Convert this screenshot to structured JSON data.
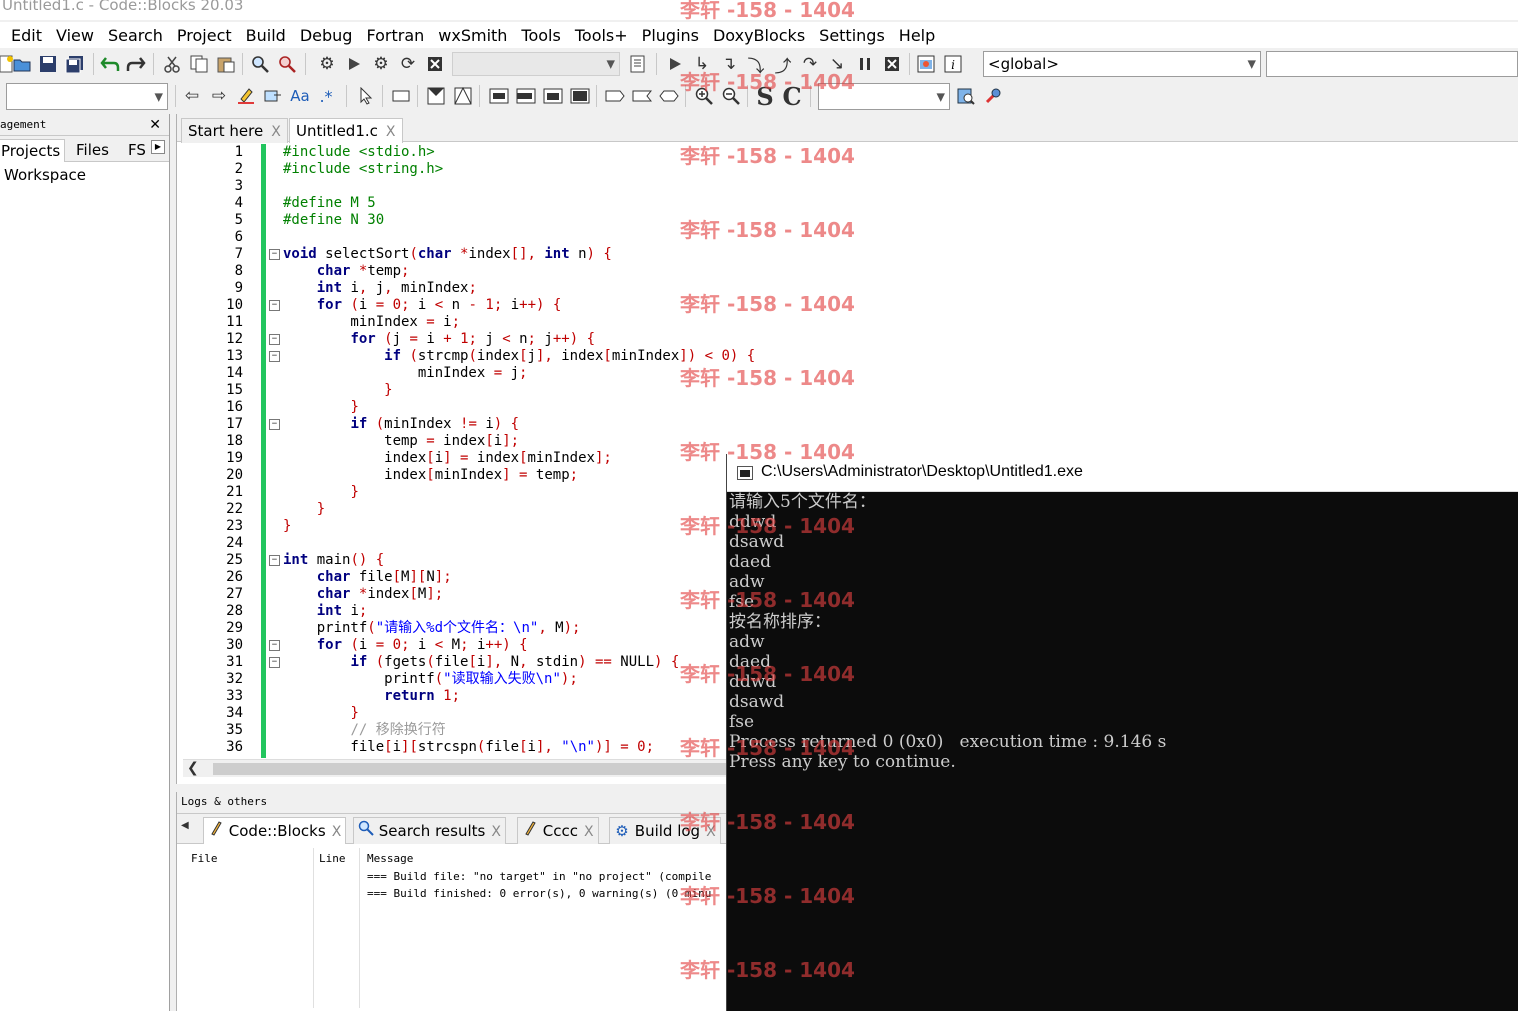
{
  "window": {
    "title": "Untitled1.c - Code::Blocks 20.03"
  },
  "menu": [
    "Edit",
    "View",
    "Search",
    "Project",
    "Build",
    "Debug",
    "Fortran",
    "wxSmith",
    "Tools",
    "Tools+",
    "Plugins",
    "DoxyBlocks",
    "Settings",
    "Help"
  ],
  "toolbar": {
    "scope_combo": "<global>",
    "target_combo": "",
    "search_combo_1": "",
    "search_combo_2": "",
    "doxy_s": "S",
    "doxy_c": "C",
    "font_a": "Aa",
    "regex": ".*"
  },
  "management": {
    "header": "Management",
    "header_visible": "agement",
    "tabs": [
      "Projects",
      "Files",
      "FS"
    ],
    "tree_root": "Workspace"
  },
  "editor": {
    "tabs": [
      {
        "label": "Start here",
        "close": "X"
      },
      {
        "label": "Untitled1.c",
        "close": "X"
      }
    ],
    "lines": [
      "#include <stdio.h>",
      "#include <string.h>",
      "",
      "#define M 5",
      "#define N 30",
      "",
      "void selectSort(char *index[], int n) {",
      "    char *temp;",
      "    int i, j, minIndex;",
      "    for (i = 0; i < n - 1; i++) {",
      "        minIndex = i;",
      "        for (j = i + 1; j < n; j++) {",
      "            if (strcmp(index[j], index[minIndex]) < 0) {",
      "                minIndex = j;",
      "            }",
      "        }",
      "        if (minIndex != i) {",
      "            temp = index[i];",
      "            index[i] = index[minIndex];",
      "            index[minIndex] = temp;",
      "        }",
      "    }",
      "}",
      "",
      "int main() {",
      "    char file[M][N];",
      "    char *index[M];",
      "    int i;",
      "    printf(\"请输入%d个文件名：\\n\", M);",
      "    for (i = 0; i < M; i++) {",
      "        if (fgets(file[i], N, stdin) == NULL) {",
      "            printf(\"读取输入失败\\n\");",
      "            return 1;",
      "        }",
      "        // 移除换行符",
      "        file[i][strcspn(file[i], \"\\n\")] = 0;"
    ]
  },
  "logs": {
    "header": "Logs & others",
    "tabs": [
      {
        "label": "Code::Blocks",
        "close": "X",
        "icon": "pencil-icon"
      },
      {
        "label": "Search results",
        "close": "X",
        "icon": "magnifier-icon"
      },
      {
        "label": "Cccc",
        "close": "X",
        "icon": "pencil-icon"
      },
      {
        "label": "Build log",
        "close": "X",
        "icon": "gear-icon"
      }
    ],
    "columns": [
      "File",
      "Line",
      "Message"
    ],
    "messages": [
      "=== Build file: \"no target\" in \"no project\" (compile",
      "=== Build finished: 0 error(s), 0 warning(s) (0 minu"
    ]
  },
  "console": {
    "title": "C:\\Users\\Administrator\\Desktop\\Untitled1.exe",
    "lines": [
      "请输入5个文件名：",
      "ddwd",
      "dsawd",
      "daed",
      "adw",
      "fse",
      "按名称排序：",
      "adw",
      "daed",
      "ddwd",
      "dsawd",
      "fse",
      "Process returned 0 (0x0)   execution time : 9.146 s",
      "Press any key to continue."
    ]
  },
  "watermark": {
    "text": "李轩 -158 - 1404"
  },
  "colors": {
    "keyword": "#00007f",
    "preprocessor": "#008000",
    "operator": "#c00000",
    "string": "#0000ff",
    "comment": "#9b9b9b",
    "change_bar": "#22c55e",
    "watermark": "#e24040"
  }
}
